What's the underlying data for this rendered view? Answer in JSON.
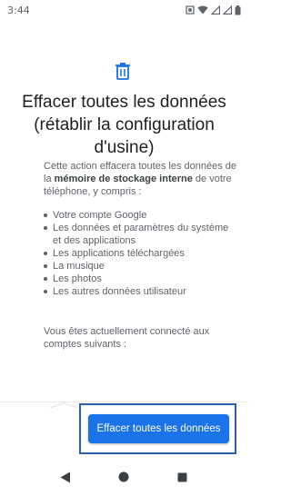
{
  "status_bar": {
    "time": "3:44",
    "icons": [
      "sim-icon",
      "wifi-icon",
      "signal-icon",
      "signal-icon",
      "battery-icon"
    ]
  },
  "header": {
    "icon": "trash-icon",
    "title_lines": [
      "Effacer toutes les données",
      "(rétablir la configuration",
      "d'usine)"
    ]
  },
  "content": {
    "desc_prefix": "Cette action effacera toutes les données de la ",
    "desc_bold": "mémoire de stockage interne",
    "desc_suffix": " de votre téléphone, y compris :",
    "bullets": [
      "Votre compte Google",
      "Les données et paramètres du système et des applications",
      "Les applications téléchargées",
      "La musique",
      "Les photos",
      "Les autres données utilisateur"
    ],
    "account_note": "Vous êtes actuellement connecté aux comptes suivants :"
  },
  "footer": {
    "erase_button_label": "Effacer toutes les données"
  },
  "nav": {
    "back": "back-icon",
    "home": "home-icon",
    "recents": "recents-icon"
  },
  "colors": {
    "accent": "#1a73e8",
    "icon_blue": "#1a73e8",
    "text_primary": "#202124",
    "text_secondary": "#5f6368"
  }
}
